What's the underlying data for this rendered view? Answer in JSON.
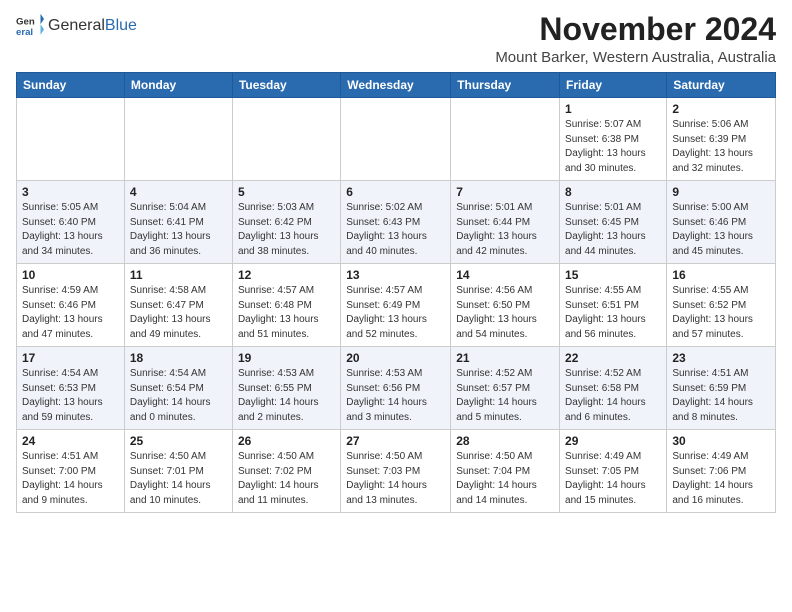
{
  "header": {
    "logo_general": "General",
    "logo_blue": "Blue",
    "title": "November 2024",
    "location": "Mount Barker, Western Australia, Australia"
  },
  "weekdays": [
    "Sunday",
    "Monday",
    "Tuesday",
    "Wednesday",
    "Thursday",
    "Friday",
    "Saturday"
  ],
  "weeks": [
    [
      {
        "day": "",
        "info": ""
      },
      {
        "day": "",
        "info": ""
      },
      {
        "day": "",
        "info": ""
      },
      {
        "day": "",
        "info": ""
      },
      {
        "day": "",
        "info": ""
      },
      {
        "day": "1",
        "info": "Sunrise: 5:07 AM\nSunset: 6:38 PM\nDaylight: 13 hours\nand 30 minutes."
      },
      {
        "day": "2",
        "info": "Sunrise: 5:06 AM\nSunset: 6:39 PM\nDaylight: 13 hours\nand 32 minutes."
      }
    ],
    [
      {
        "day": "3",
        "info": "Sunrise: 5:05 AM\nSunset: 6:40 PM\nDaylight: 13 hours\nand 34 minutes."
      },
      {
        "day": "4",
        "info": "Sunrise: 5:04 AM\nSunset: 6:41 PM\nDaylight: 13 hours\nand 36 minutes."
      },
      {
        "day": "5",
        "info": "Sunrise: 5:03 AM\nSunset: 6:42 PM\nDaylight: 13 hours\nand 38 minutes."
      },
      {
        "day": "6",
        "info": "Sunrise: 5:02 AM\nSunset: 6:43 PM\nDaylight: 13 hours\nand 40 minutes."
      },
      {
        "day": "7",
        "info": "Sunrise: 5:01 AM\nSunset: 6:44 PM\nDaylight: 13 hours\nand 42 minutes."
      },
      {
        "day": "8",
        "info": "Sunrise: 5:01 AM\nSunset: 6:45 PM\nDaylight: 13 hours\nand 44 minutes."
      },
      {
        "day": "9",
        "info": "Sunrise: 5:00 AM\nSunset: 6:46 PM\nDaylight: 13 hours\nand 45 minutes."
      }
    ],
    [
      {
        "day": "10",
        "info": "Sunrise: 4:59 AM\nSunset: 6:46 PM\nDaylight: 13 hours\nand 47 minutes."
      },
      {
        "day": "11",
        "info": "Sunrise: 4:58 AM\nSunset: 6:47 PM\nDaylight: 13 hours\nand 49 minutes."
      },
      {
        "day": "12",
        "info": "Sunrise: 4:57 AM\nSunset: 6:48 PM\nDaylight: 13 hours\nand 51 minutes."
      },
      {
        "day": "13",
        "info": "Sunrise: 4:57 AM\nSunset: 6:49 PM\nDaylight: 13 hours\nand 52 minutes."
      },
      {
        "day": "14",
        "info": "Sunrise: 4:56 AM\nSunset: 6:50 PM\nDaylight: 13 hours\nand 54 minutes."
      },
      {
        "day": "15",
        "info": "Sunrise: 4:55 AM\nSunset: 6:51 PM\nDaylight: 13 hours\nand 56 minutes."
      },
      {
        "day": "16",
        "info": "Sunrise: 4:55 AM\nSunset: 6:52 PM\nDaylight: 13 hours\nand 57 minutes."
      }
    ],
    [
      {
        "day": "17",
        "info": "Sunrise: 4:54 AM\nSunset: 6:53 PM\nDaylight: 13 hours\nand 59 minutes."
      },
      {
        "day": "18",
        "info": "Sunrise: 4:54 AM\nSunset: 6:54 PM\nDaylight: 14 hours\nand 0 minutes."
      },
      {
        "day": "19",
        "info": "Sunrise: 4:53 AM\nSunset: 6:55 PM\nDaylight: 14 hours\nand 2 minutes."
      },
      {
        "day": "20",
        "info": "Sunrise: 4:53 AM\nSunset: 6:56 PM\nDaylight: 14 hours\nand 3 minutes."
      },
      {
        "day": "21",
        "info": "Sunrise: 4:52 AM\nSunset: 6:57 PM\nDaylight: 14 hours\nand 5 minutes."
      },
      {
        "day": "22",
        "info": "Sunrise: 4:52 AM\nSunset: 6:58 PM\nDaylight: 14 hours\nand 6 minutes."
      },
      {
        "day": "23",
        "info": "Sunrise: 4:51 AM\nSunset: 6:59 PM\nDaylight: 14 hours\nand 8 minutes."
      }
    ],
    [
      {
        "day": "24",
        "info": "Sunrise: 4:51 AM\nSunset: 7:00 PM\nDaylight: 14 hours\nand 9 minutes."
      },
      {
        "day": "25",
        "info": "Sunrise: 4:50 AM\nSunset: 7:01 PM\nDaylight: 14 hours\nand 10 minutes."
      },
      {
        "day": "26",
        "info": "Sunrise: 4:50 AM\nSunset: 7:02 PM\nDaylight: 14 hours\nand 11 minutes."
      },
      {
        "day": "27",
        "info": "Sunrise: 4:50 AM\nSunset: 7:03 PM\nDaylight: 14 hours\nand 13 minutes."
      },
      {
        "day": "28",
        "info": "Sunrise: 4:50 AM\nSunset: 7:04 PM\nDaylight: 14 hours\nand 14 minutes."
      },
      {
        "day": "29",
        "info": "Sunrise: 4:49 AM\nSunset: 7:05 PM\nDaylight: 14 hours\nand 15 minutes."
      },
      {
        "day": "30",
        "info": "Sunrise: 4:49 AM\nSunset: 7:06 PM\nDaylight: 14 hours\nand 16 minutes."
      }
    ]
  ]
}
